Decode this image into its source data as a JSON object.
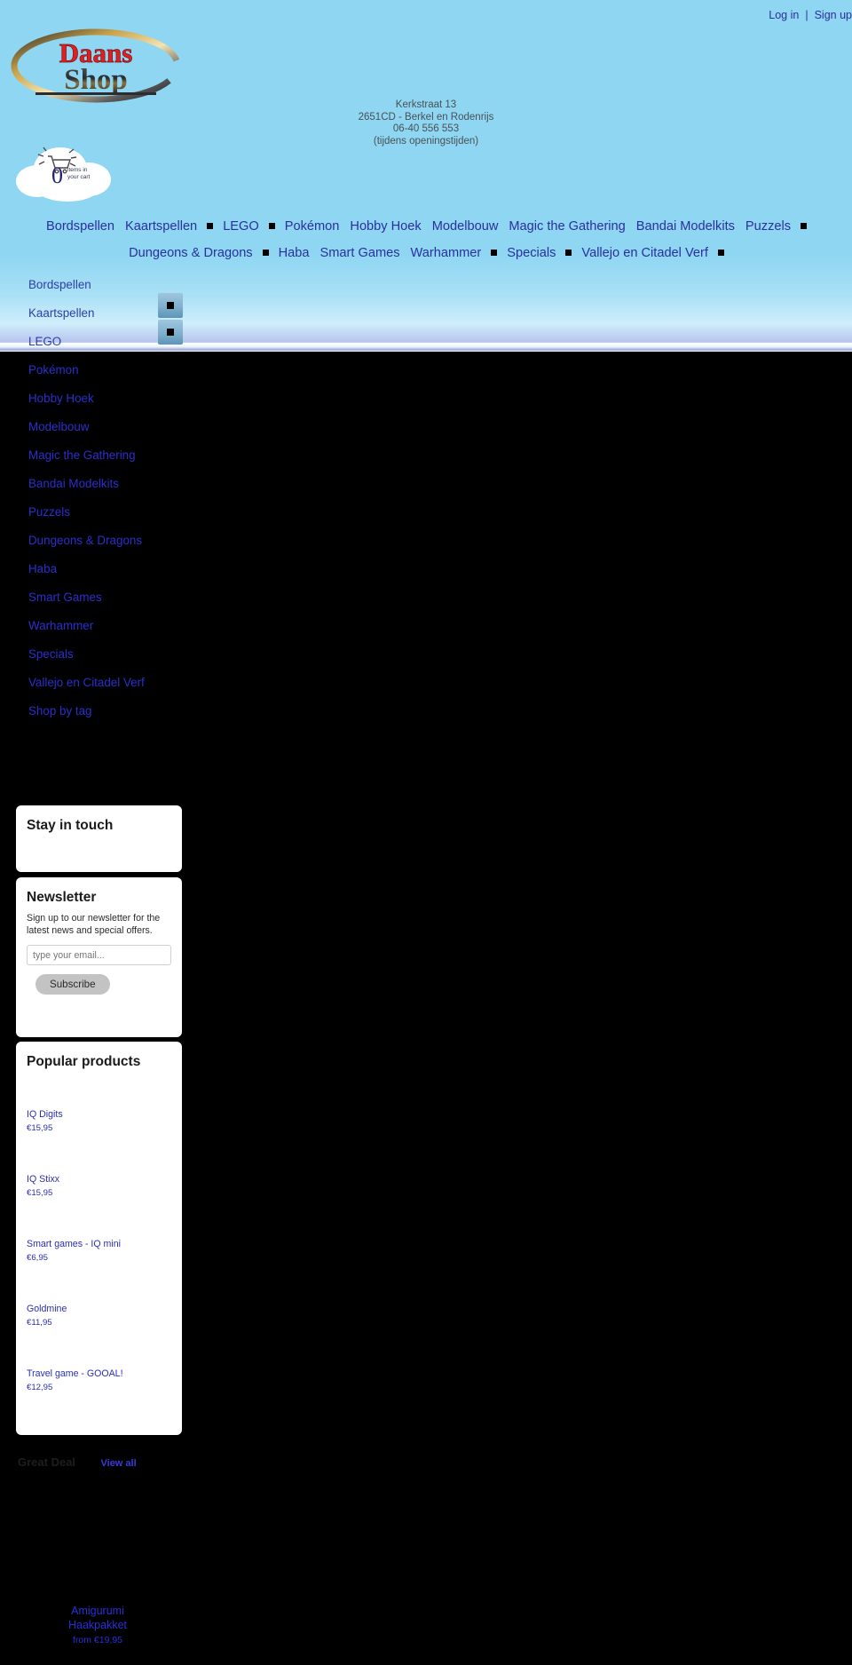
{
  "header": {
    "account": {
      "login": "Log in",
      "separator": "|",
      "signup": "Sign up"
    },
    "logo": {
      "line1": "Daans",
      "line2": "Shop"
    },
    "address": {
      "street": "Kerkstraat 13",
      "city": "2651CD - Berkel en Rodenrijs",
      "phone": "06-40 556 553",
      "hours": "(tijdens openingstijden)"
    },
    "cart": {
      "count": "0",
      "label_line1": "items in",
      "label_line2": "your cart",
      "icon": "shopping-cart-icon"
    }
  },
  "mainnav": {
    "row1": [
      {
        "label": "Bordspellen",
        "square": false
      },
      {
        "label": "Kaartspellen",
        "square": true
      },
      {
        "label": "LEGO",
        "square": true
      },
      {
        "label": "Pokémon",
        "square": false
      },
      {
        "label": "Hobby Hoek",
        "square": false
      },
      {
        "label": "Modelbouw",
        "square": false
      },
      {
        "label": "Magic the Gathering",
        "square": false
      },
      {
        "label": "Bandai Modelkits",
        "square": false
      },
      {
        "label": "Puzzels",
        "square": true
      }
    ],
    "row2": [
      {
        "label": "Dungeons & Dragons",
        "square": true
      },
      {
        "label": "Haba",
        "square": false
      },
      {
        "label": "Smart Games",
        "square": false
      },
      {
        "label": "Warhammer",
        "square": true
      },
      {
        "label": "Specials",
        "square": true
      },
      {
        "label": "Vallejo en Citadel Verf",
        "square": true
      }
    ]
  },
  "sidebar": {
    "categories": [
      "Bordspellen",
      "Kaartspellen",
      "LEGO",
      "Pokémon",
      "Hobby Hoek",
      "Modelbouw",
      "Magic the Gathering",
      "Bandai Modelkits",
      "Puzzels",
      "Dungeons & Dragons",
      "Haba",
      "Smart Games",
      "Warhammer",
      "Specials",
      "Vallejo en Citadel Verf",
      "Shop by tag"
    ],
    "stay_in_touch": {
      "title": "Stay in touch"
    },
    "newsletter": {
      "title": "Newsletter",
      "text": "Sign up to our newsletter for the latest news and special offers.",
      "input_placeholder": "type your email...",
      "input_value": "",
      "button": "Subscribe"
    },
    "popular": {
      "title": "Popular products",
      "items": [
        {
          "name": "IQ Digits",
          "price": "€15,95"
        },
        {
          "name": "IQ Stixx",
          "price": "€15,95"
        },
        {
          "name": "Smart games - IQ mini",
          "price": "€6,95"
        },
        {
          "name": "Goldmine",
          "price": "€11,95"
        },
        {
          "name": "Travel game - GOOAL!",
          "price": "€12,95"
        }
      ]
    }
  },
  "deals": {
    "title": "Great Deal",
    "view_all": "View all",
    "featured": {
      "name_line1": "Amigurumi",
      "name_line2": "Haakpakket",
      "price": "from €19,95"
    }
  },
  "colors": {
    "sky": "#8ed6f2",
    "link": "#2b2f9e",
    "page_bg": "#000000",
    "card_bg": "#ffffff"
  }
}
